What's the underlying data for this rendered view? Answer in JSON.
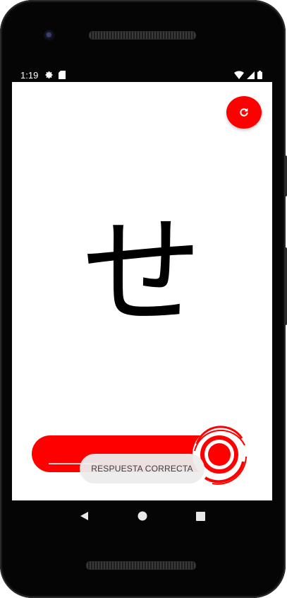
{
  "status_bar": {
    "time": "1:19",
    "left_icons": [
      "gear-icon",
      "sd-card-icon"
    ],
    "right_icons": [
      "wifi-icon",
      "signal-icon",
      "battery-icon"
    ]
  },
  "card": {
    "character": "せ"
  },
  "refresh_button": {
    "icon": "refresh-icon"
  },
  "answer_slider": {
    "accent": "#ff0000"
  },
  "toast": {
    "message": "RESPUESTA CORRECTA"
  },
  "nav_bar": {
    "buttons": [
      "back-icon",
      "home-icon",
      "recents-icon"
    ]
  },
  "colors": {
    "accent": "#ff0000",
    "background": "#ffffff"
  }
}
